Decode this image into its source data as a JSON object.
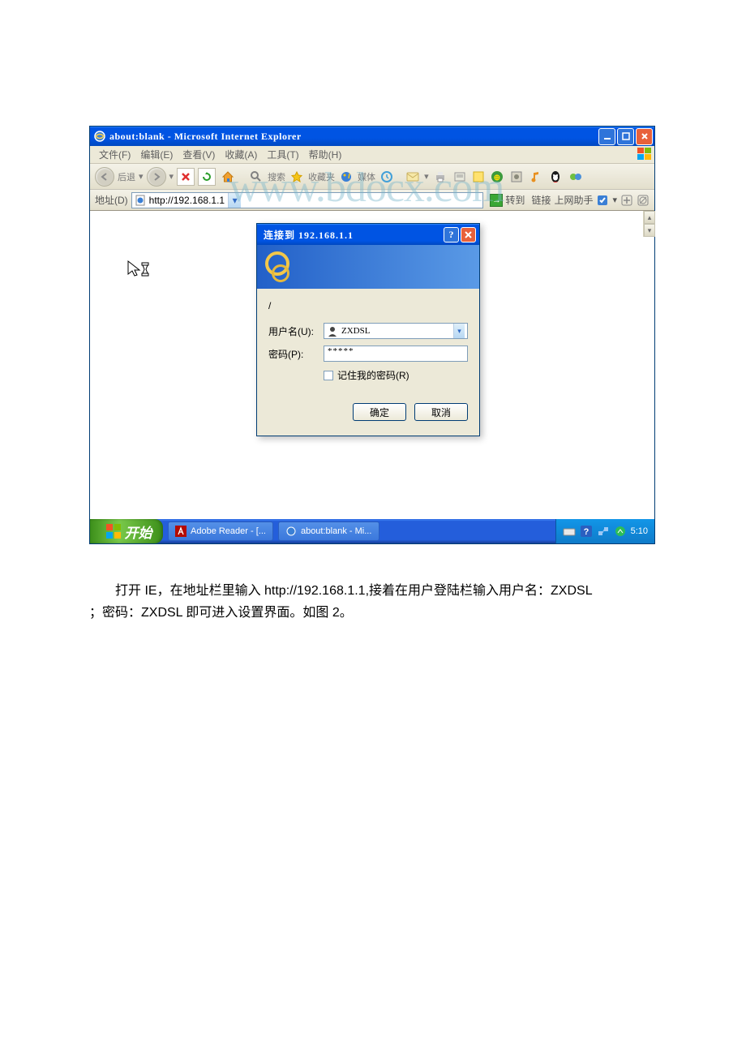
{
  "window": {
    "title": "about:blank - Microsoft Internet Explorer"
  },
  "menu": {
    "file": "文件(F)",
    "edit": "编辑(E)",
    "view": "查看(V)",
    "favorites": "收藏(A)",
    "tools": "工具(T)",
    "help": "帮助(H)"
  },
  "toolbar": {
    "back": "后退",
    "search": "搜索",
    "favorites": "收藏夹",
    "media": "媒体"
  },
  "address": {
    "label": "地址(D)",
    "url": "http://192.168.1.1",
    "go": "转到",
    "links": "链接",
    "helper": "上网助手"
  },
  "auth": {
    "title": "连接到 192.168.1.1",
    "realm": "/",
    "user_label": "用户名(U):",
    "user_value": "ZXDSL",
    "pwd_label": "密码(P):",
    "pwd_value": "*****",
    "remember": "记住我的密码(R)",
    "ok": "确定",
    "cancel": "取消"
  },
  "taskbar": {
    "start": "开始",
    "task1": "Adobe Reader - [...",
    "task2": "about:blank - Mi...",
    "clock": "5:10"
  },
  "watermark": "www.bdocx.com",
  "caption": {
    "line1a": "打开 IE，在地址栏里输入 ",
    "line1b": "http://192.168.1.1,",
    "line1c": "接着在用户登陆栏输入用户名：ZXDSL",
    "line2": "；密码：ZXDSL 即可进入设置界面。如图 2。"
  }
}
